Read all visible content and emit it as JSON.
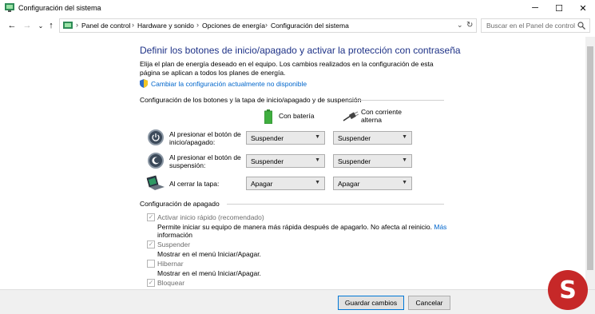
{
  "window": {
    "title": "Configuración del sistema"
  },
  "controls": {
    "minimize": "─",
    "maximize": "☐",
    "close": "✕"
  },
  "nav": {
    "back": "←",
    "forward": "→",
    "dropdown": "⌄",
    "up": "↑",
    "breadcrumb": [
      "Panel de control",
      "Hardware y sonido",
      "Opciones de energía",
      "Configuración del sistema"
    ],
    "separator": "›",
    "history": "⌄",
    "refresh": "↻"
  },
  "search": {
    "placeholder": "Buscar en el Panel de control",
    "icon": "search-icon"
  },
  "main": {
    "heading": "Definir los botones de inicio/apagado y activar la protección con contraseña",
    "description": "Elija el plan de energía deseado en el equipo. Los cambios realizados en la configuración de esta página se aplican a todos los planes de energía.",
    "unavailable_link": "Cambiar la configuración actualmente no disponible"
  },
  "buttons_section": {
    "title": "Configuración de los botones y la tapa de inicio/apagado y de suspensión",
    "col_battery": "Con batería",
    "col_ac_line1": "Con corriente",
    "col_ac_line2": "alterna",
    "rows": [
      {
        "label_line1": "Al presionar el botón de",
        "label_line2": "inicio/apagado:",
        "battery": "Suspender",
        "ac": "Suspender"
      },
      {
        "label_line1": "Al presionar el botón de",
        "label_line2": "suspensión:",
        "battery": "Suspender",
        "ac": "Suspender"
      },
      {
        "label_line1": "Al cerrar la tapa:",
        "label_line2": "",
        "battery": "Apagar",
        "ac": "Apagar"
      }
    ]
  },
  "shutdown_section": {
    "title": "Configuración de apagado",
    "items": [
      {
        "label": "Activar inicio rápido (recomendado)",
        "checked": true,
        "desc": "Permite iniciar su equipo de manera más rápida después de apagarlo. No afecta al reinicio.",
        "link1": "Más",
        "link2": "información"
      },
      {
        "label": "Suspender",
        "checked": true,
        "desc": "Mostrar en el menú Iniciar/Apagar."
      },
      {
        "label": "Hibernar",
        "checked": false,
        "desc": "Mostrar en el menú Iniciar/Apagar."
      },
      {
        "label": "Bloquear",
        "checked": true
      }
    ],
    "check_glyph": "✓"
  },
  "footer": {
    "save": "Guardar cambios",
    "cancel": "Cancelar"
  },
  "watermark": {
    "text": "S"
  },
  "colors": {
    "heading": "#1e3287",
    "link": "#0066cc",
    "watermark": "#c62828"
  }
}
